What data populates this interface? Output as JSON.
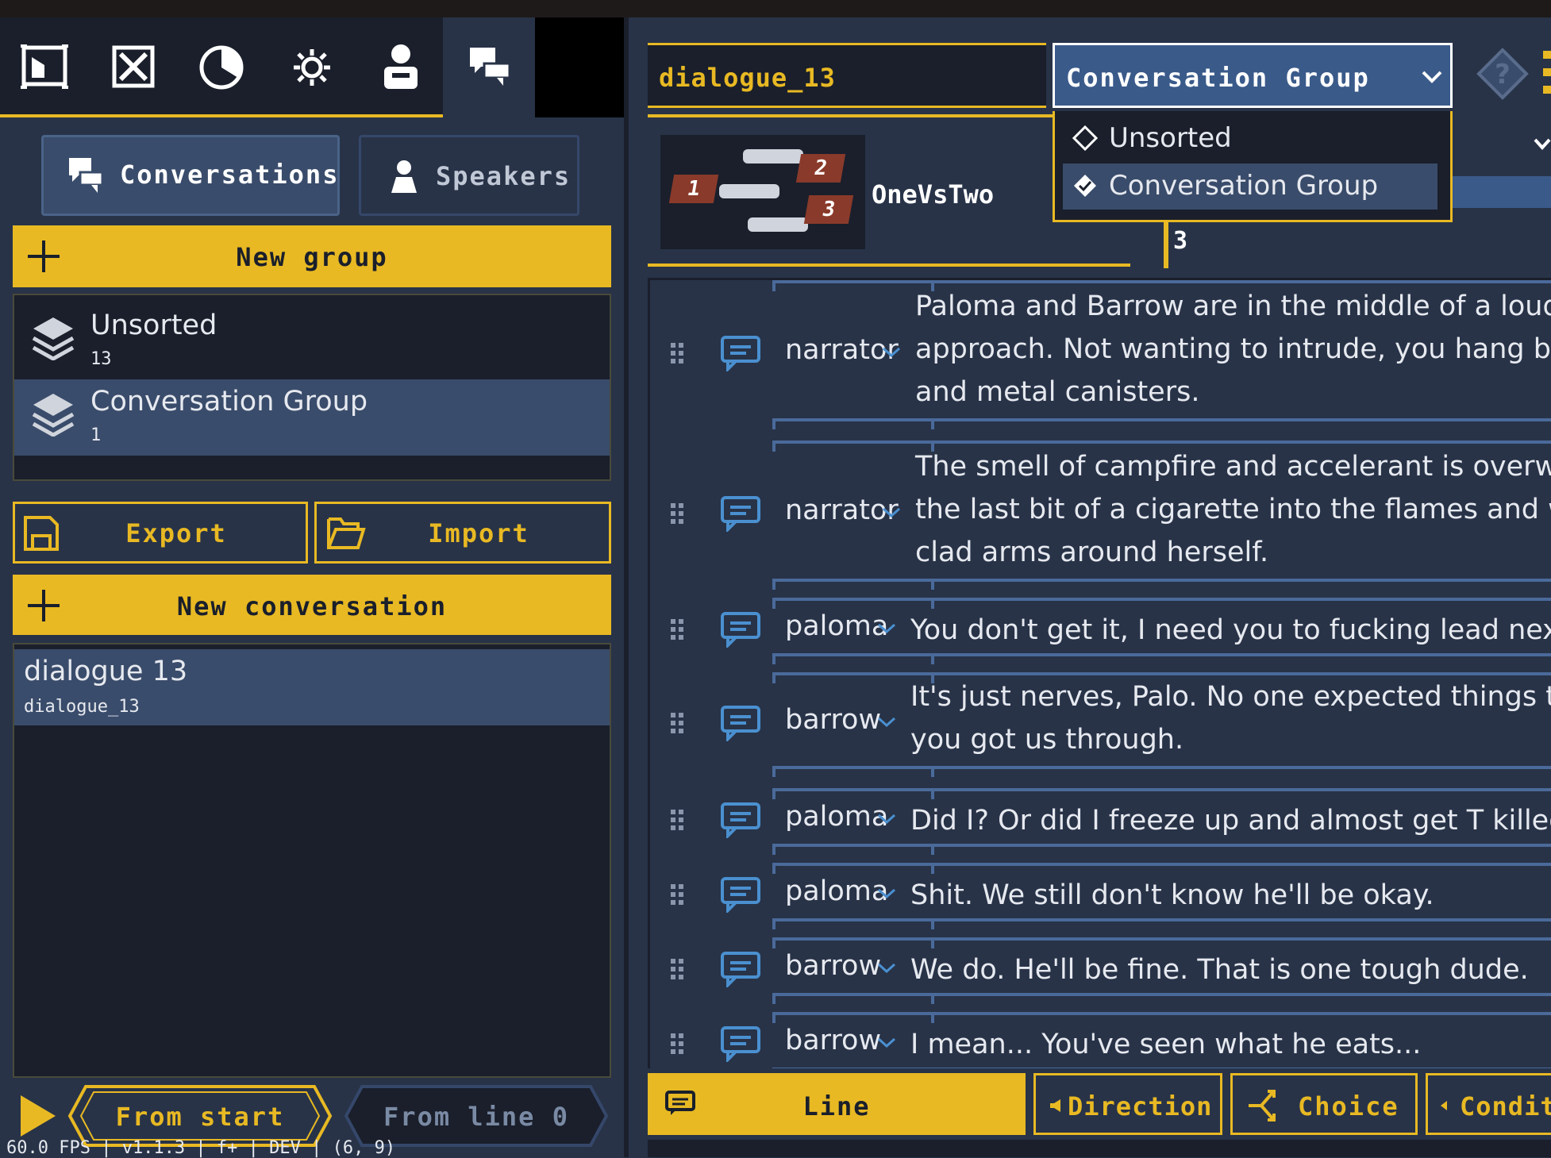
{
  "toolbar": {
    "tabs": [
      "Conversations",
      "Speakers"
    ]
  },
  "left": {
    "new_group": "New group",
    "groups": [
      {
        "name": "Unsorted",
        "count": "13"
      },
      {
        "name": "Conversation Group",
        "count": "1"
      }
    ],
    "export": "Export",
    "import": "Import",
    "new_conversation": "New conversation",
    "conversations": [
      {
        "title": "dialogue 13",
        "id": "dialogue_13"
      }
    ],
    "from_start": "From start",
    "from_line": "From line 0",
    "status": "60.0 FPS | v1.1.3 | f+ | DEV | (6, 9)"
  },
  "editor": {
    "id_value": "dialogue_13",
    "group_select": "Conversation Group",
    "dropdown_options": [
      "Unsorted",
      "Conversation Group"
    ],
    "thumb_numbers": [
      "1",
      "2",
      "3"
    ],
    "scene_name": "OneVsTwo",
    "count": "3",
    "lines": [
      {
        "speaker": "narrator",
        "text": [
          "Paloma and Barrow are in the middle of a loud discu",
          "approach. Not wanting to intrude, you hang back, b",
          "and metal canisters."
        ]
      },
      {
        "speaker": "narrator",
        "text": [
          "The smell of campfire and accelerant is overwhelmi",
          "the last bit of a cigarette into the flames and wraps",
          "clad arms around herself."
        ]
      },
      {
        "speaker": "paloma",
        "text": [
          "You don't get it, I need you to fucking lead next time"
        ]
      },
      {
        "speaker": "barrow",
        "text": [
          "It's just nerves, Palo. No one expected things to go d",
          "you got us through."
        ]
      },
      {
        "speaker": "paloma",
        "text": [
          "Did I? Or did I freeze up and almost get T killed?"
        ]
      },
      {
        "speaker": "paloma",
        "text": [
          "Shit. We still don't know he'll be okay."
        ]
      },
      {
        "speaker": "barrow",
        "text": [
          "We do. He'll be fine. That is one tough dude."
        ]
      },
      {
        "speaker": "barrow",
        "text": [
          "I mean... You've seen what he eats..."
        ]
      }
    ],
    "bottom_buttons": {
      "line": "Line",
      "direction": "Direction",
      "choice": "Choice",
      "condition": "Condit"
    }
  }
}
